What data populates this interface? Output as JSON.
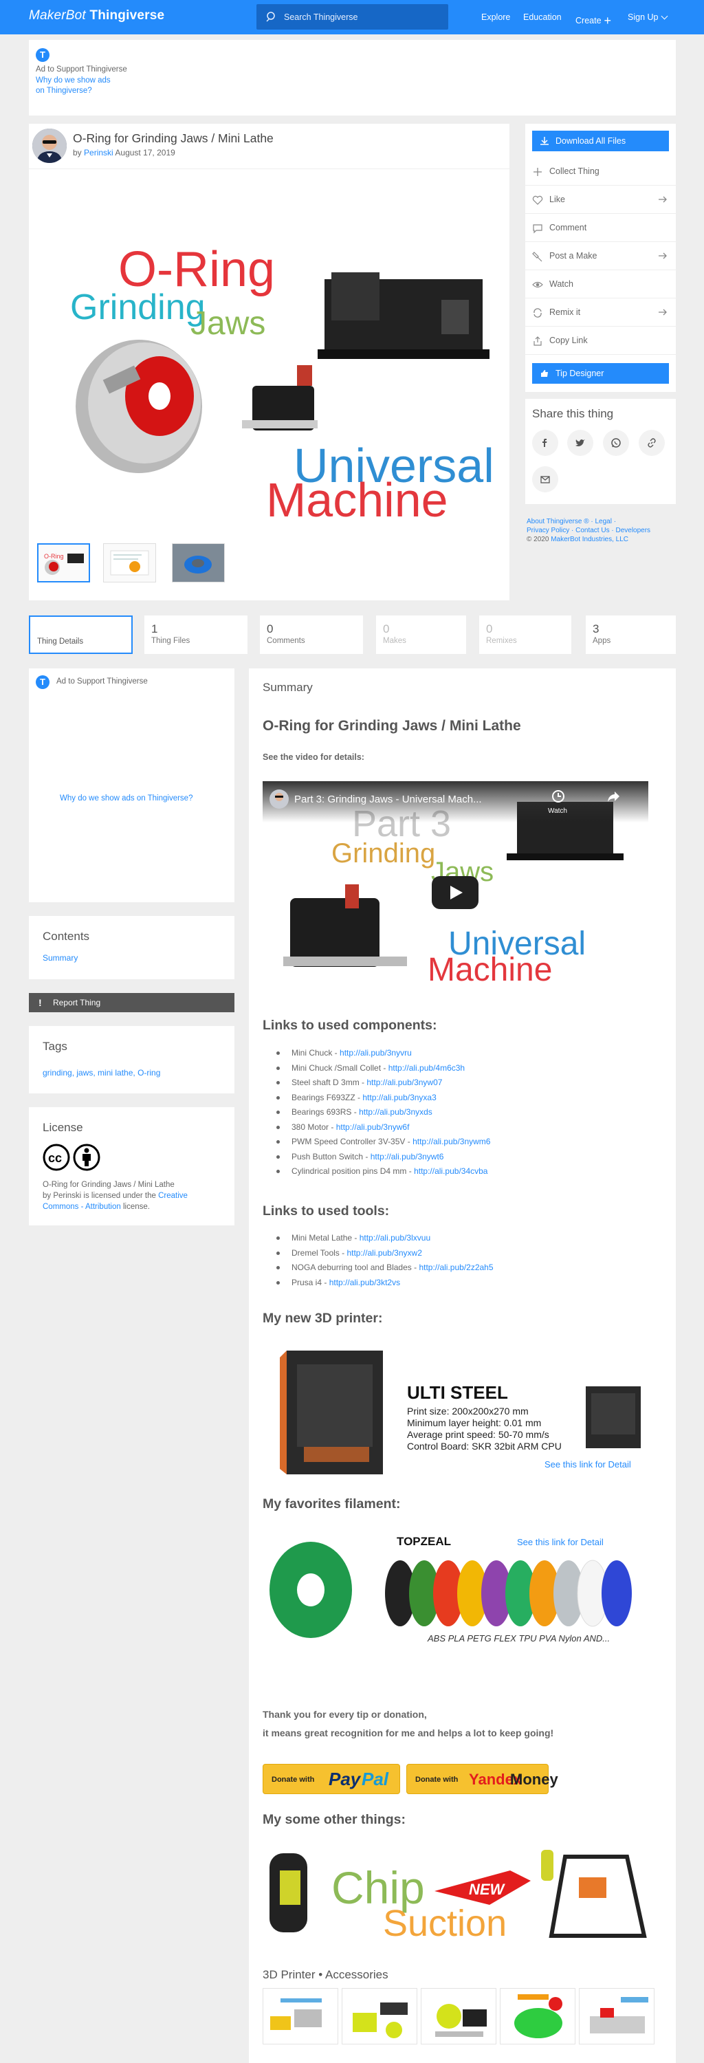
{
  "header": {
    "logo_prefix": "MakerBot",
    "logo_name": "Thingiverse",
    "search_placeholder": "Search Thingiverse",
    "nav": [
      "Explore",
      "Education",
      "Create",
      "Sign Up"
    ]
  },
  "ad": {
    "badge": "T",
    "label": "Ad to Support Thingiverse",
    "why_line1": "Why do we show ads",
    "why_line2": "on Thingiverse?",
    "side_why": "Why do we show ads on Thingiverse?"
  },
  "thing": {
    "title": "O-Ring for Grinding Jaws / Mini Lathe",
    "by": "by",
    "author": "Perinski",
    "date": "August 17, 2019",
    "hero": {
      "word1": "O-Ring",
      "word2": "Grinding",
      "word3": "Jaws",
      "word4": "Universal",
      "word5": "Machine"
    }
  },
  "actions": {
    "download": "Download All Files",
    "items": [
      "Collect Thing",
      "Like",
      "Comment",
      "Post a Make",
      "Watch",
      "Remix it",
      "Copy Link"
    ],
    "tip": "Tip Designer"
  },
  "share": {
    "title": "Share this thing"
  },
  "footer": {
    "line1": "About Thingiverse ® · Legal ·",
    "line2": "Privacy Policy · Contact Us · Developers",
    "copyright": "© 2020",
    "company": "MakerBot Industries, LLC"
  },
  "stats": [
    {
      "num": "",
      "label": "Thing Details"
    },
    {
      "num": "1",
      "label": "Thing Files"
    },
    {
      "num": "0",
      "label": "Comments"
    },
    {
      "num": "0",
      "label": "Makes"
    },
    {
      "num": "0",
      "label": "Remixes"
    },
    {
      "num": "3",
      "label": "Apps"
    }
  ],
  "sidebar": {
    "contents_title": "Contents",
    "contents_link": "Summary",
    "report": "Report Thing",
    "tags_title": "Tags",
    "tags": "grinding, jaws, mini lathe, O-ring",
    "license_title": "License",
    "license_p1": "O-Ring for Grinding Jaws / Mini Lathe",
    "license_p2": "by Perinski is licensed under the",
    "license_link1": "Creative",
    "license_link2": "Commons - Attribution",
    "license_p3": "license."
  },
  "summary": {
    "heading": "Summary",
    "title": "O-Ring for Grinding Jaws / Mini Lathe",
    "video_note": "See the video for details:",
    "video": {
      "title": "Part 3: Grinding Jaws - Universal Mach...",
      "overlay1": "Part 3",
      "overlay2": "Grinding",
      "overlay3": "Jaws",
      "overlay4": "Universal",
      "overlay5": "Machine",
      "watch": "Watch"
    },
    "components_h": "Links to used components:",
    "components": [
      {
        "name": "Mini Chuck - ",
        "url": "http://ali.pub/3nyvru"
      },
      {
        "name": "Mini Chuck /Small Collet - ",
        "url": "http://ali.pub/4m6c3h"
      },
      {
        "name": "Steel shaft D 3mm - ",
        "url": "http://ali.pub/3nyw07"
      },
      {
        "name": "Bearings F693ZZ - ",
        "url": "http://ali.pub/3nyxa3"
      },
      {
        "name": "Bearings 693RS - ",
        "url": "http://ali.pub/3nyxds"
      },
      {
        "name": "380 Motor - ",
        "url": "http://ali.pub/3nyw6f"
      },
      {
        "name": "PWM Speed Controller 3V-35V - ",
        "url": "http://ali.pub/3nywm6"
      },
      {
        "name": "Push Button Switch - ",
        "url": "http://ali.pub/3nywt6"
      },
      {
        "name": "Cylindrical position pins D4 mm - ",
        "url": "http://ali.pub/34cvba"
      }
    ],
    "tools_h": "Links to used tools:",
    "tools": [
      {
        "name": "Mini Metal Lathe - ",
        "url": "http://ali.pub/3lxvuu"
      },
      {
        "name": "Dremel Tools - ",
        "url": "http://ali.pub/3nyxw2"
      },
      {
        "name": "NOGA deburring tool and Blades - ",
        "url": "http://ali.pub/2z2ah5"
      },
      {
        "name": "Prusa i4 - ",
        "url": "http://ali.pub/3kt2vs"
      }
    ],
    "printer_h": "My new 3D printer:",
    "printer": {
      "brand": "ULTI STEEL",
      "spec1": "Print size: 200x200x270 mm",
      "spec2": "Minimum layer height: 0.01 mm",
      "spec3": "Average print speed: 50-70 mm/s",
      "spec4": "Control Board: SKR 32bit ARM CPU",
      "link": "See this link for Detail"
    },
    "filament_h": "My favorites filament:",
    "filament": {
      "brand": "TOPZEAL",
      "link": "See this link for Detail",
      "types": "ABS PLA PETG FLEX TPU PVA Nylon AND..."
    },
    "thanks1": "Thank you for every tip or donation,",
    "thanks2": "it means great recognition for me and helps a lot to keep going!",
    "donate_small": "Donate with",
    "donate_paypal_a": "Pay",
    "donate_paypal_b": "Pal",
    "donate_yandex_a": "Yandex",
    "donate_yandex_b": "Money",
    "other_h": "My some other things:",
    "chip1": "Chip",
    "chip2": "Suction",
    "chip_new": "NEW",
    "accessories_h": "3D Printer • Accessories"
  }
}
